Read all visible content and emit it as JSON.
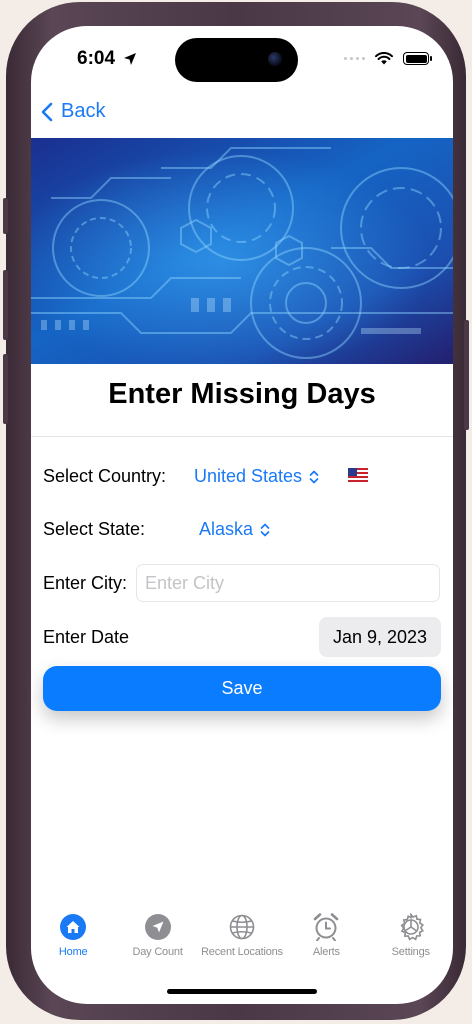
{
  "status_bar": {
    "time": "6:04"
  },
  "nav": {
    "back_label": "Back"
  },
  "page": {
    "title": "Enter Missing Days"
  },
  "form": {
    "country_label": "Select Country:",
    "country_value": "United States",
    "country_flag": "flag-us-icon",
    "state_label": "Select State:",
    "state_value": "Alaska",
    "city_label": "Enter City:",
    "city_value": "",
    "city_placeholder": "Enter City",
    "date_label": "Enter Date",
    "date_value": "Jan 9, 2023",
    "save_label": "Save"
  },
  "tabs": [
    {
      "label": "Home",
      "icon": "home-icon",
      "active": true
    },
    {
      "label": "Day Count",
      "icon": "location-arrow-icon",
      "active": false
    },
    {
      "label": "Recent Locations",
      "icon": "globe-icon",
      "active": false
    },
    {
      "label": "Alerts",
      "icon": "alarm-clock-icon",
      "active": false
    },
    {
      "label": "Settings",
      "icon": "gear-icon",
      "active": false
    }
  ],
  "colors": {
    "accent": "#1a7af6",
    "save_button": "#0a7cff",
    "tab_inactive": "#8e8e93"
  }
}
